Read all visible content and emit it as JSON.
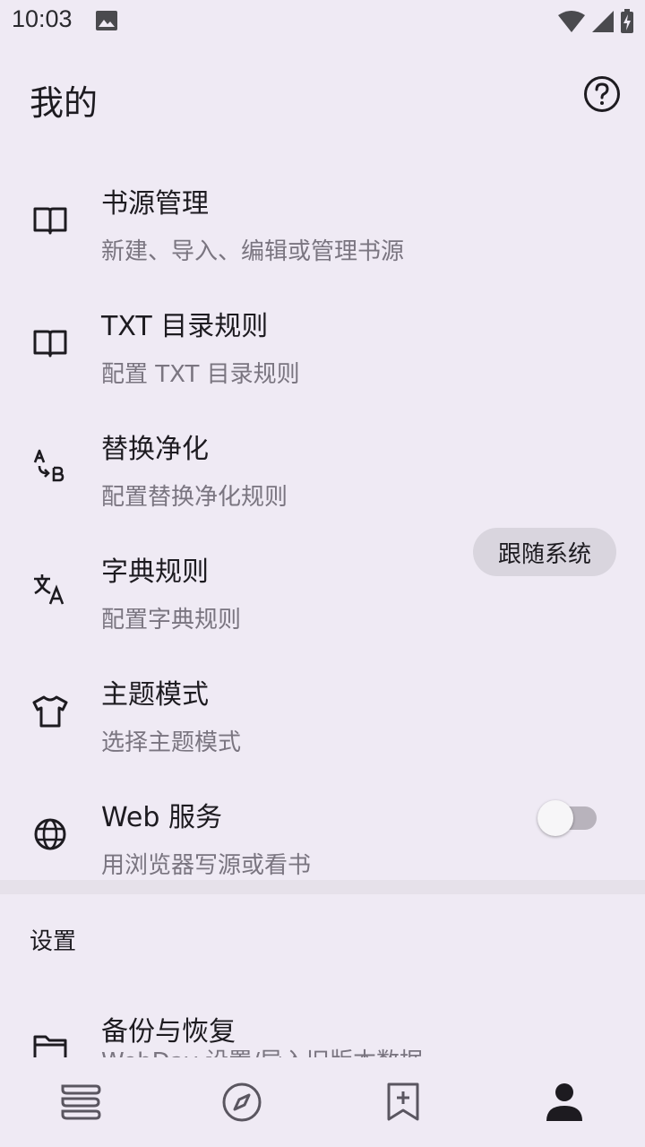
{
  "status_bar": {
    "time": "10:03"
  },
  "header": {
    "title": "我的"
  },
  "items": [
    {
      "title": "书源管理",
      "subtitle": "新建、导入、编辑或管理书源",
      "icon": "book-open-icon"
    },
    {
      "title": "TXT 目录规则",
      "subtitle": "配置 TXT 目录规则",
      "icon": "book-open-icon"
    },
    {
      "title": "替换净化",
      "subtitle": "配置替换净化规则",
      "icon": "replace-ab-icon"
    },
    {
      "title": "字典规则",
      "subtitle": "配置字典规则",
      "icon": "translate-icon"
    },
    {
      "title": "主题模式",
      "subtitle": "选择主题模式",
      "icon": "tshirt-icon",
      "chip": "跟随系统"
    },
    {
      "title": "Web 服务",
      "subtitle": "用浏览器写源或看书",
      "icon": "globe-icon",
      "toggle_on": false
    },
    {
      "title": "备份与恢复",
      "subtitle": "WebDav 设置/导入旧版本数据",
      "icon": "folder-icon"
    }
  ],
  "section": {
    "label": "设置"
  },
  "bottom_nav": [
    {
      "name": "bookshelf",
      "icon": "bookshelf-icon"
    },
    {
      "name": "explore",
      "icon": "compass-icon"
    },
    {
      "name": "rss",
      "icon": "bookmark-add-icon"
    },
    {
      "name": "my",
      "icon": "person-icon",
      "selected": true
    }
  ]
}
